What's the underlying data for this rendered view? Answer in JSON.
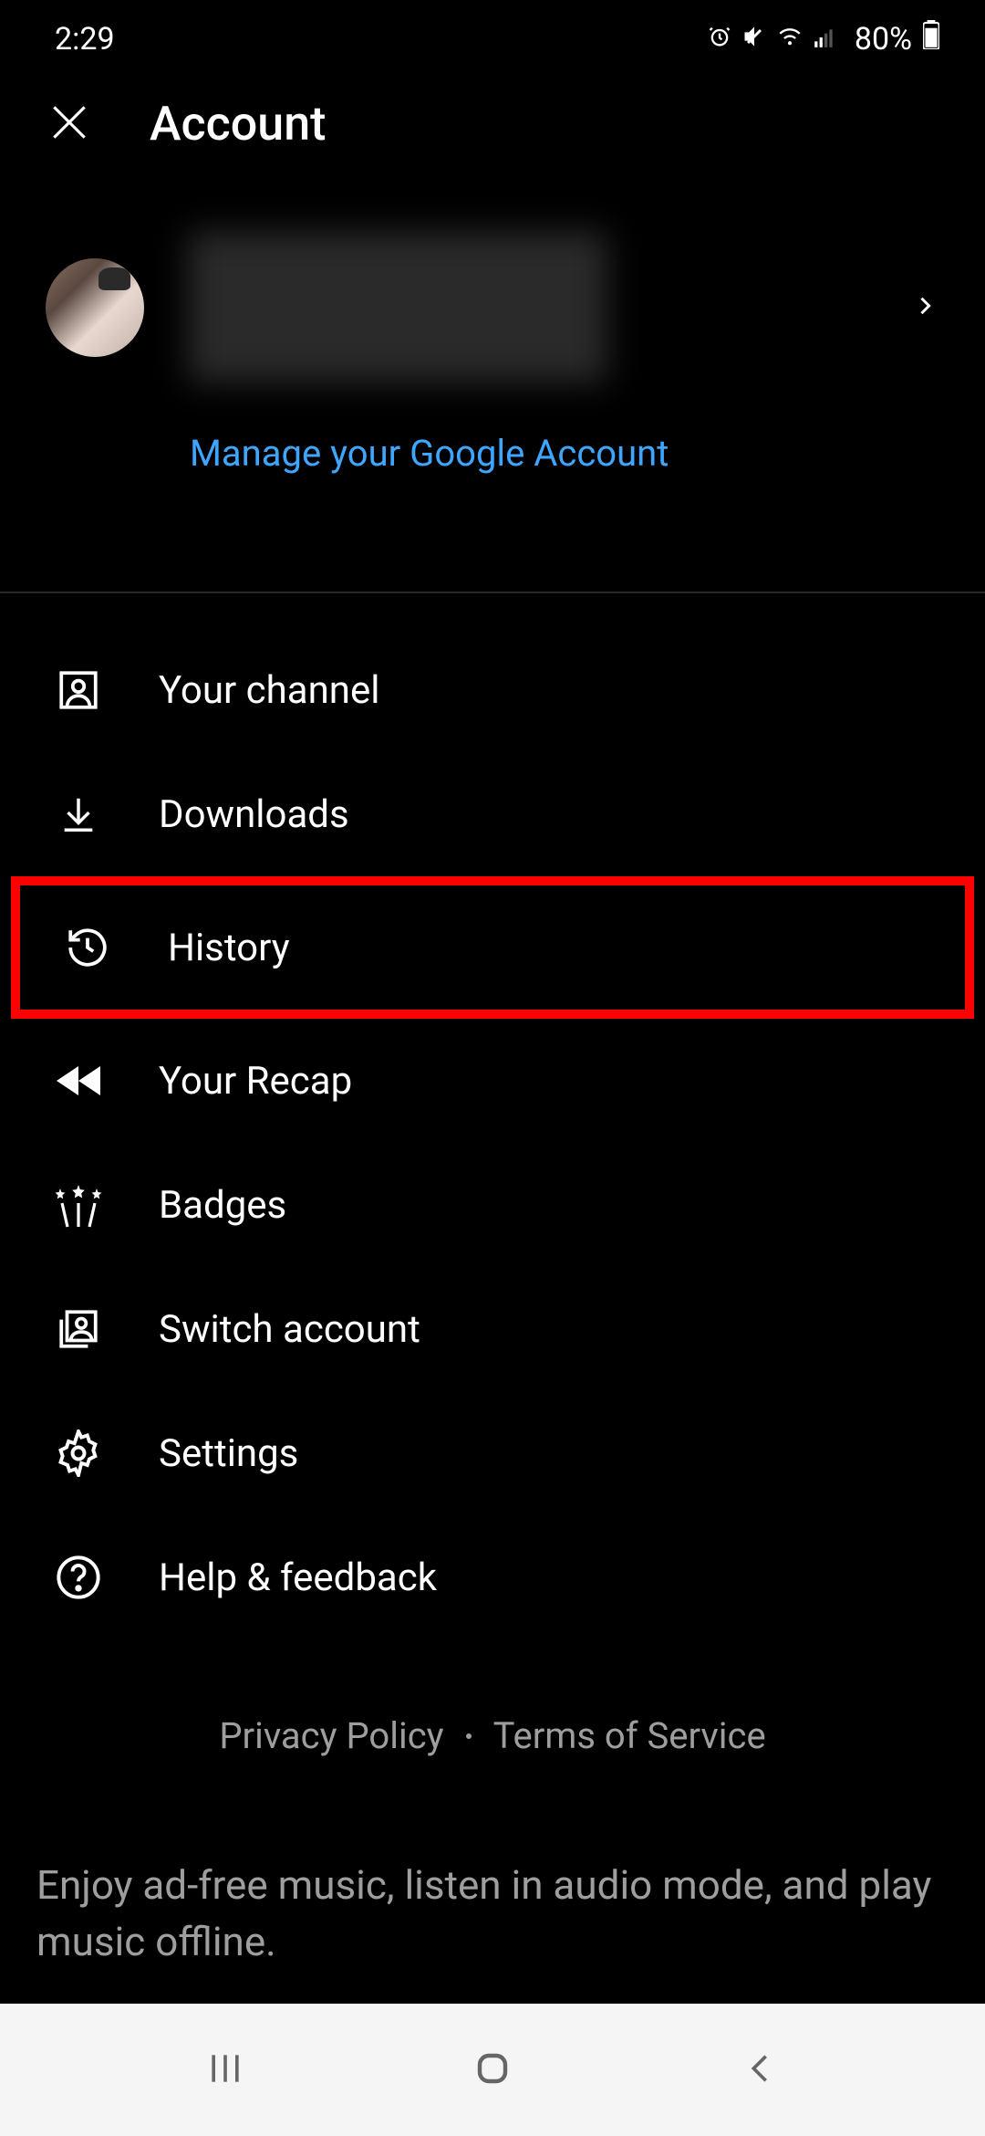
{
  "status": {
    "time": "2:29",
    "battery": "80%"
  },
  "header": {
    "title": "Account"
  },
  "profile": {
    "manage_link": "Manage your Google Account"
  },
  "menu": {
    "items": [
      {
        "icon": "person-box",
        "label": "Your channel"
      },
      {
        "icon": "download",
        "label": "Downloads"
      },
      {
        "icon": "history",
        "label": "History"
      },
      {
        "icon": "rewind",
        "label": "Your Recap"
      },
      {
        "icon": "badges",
        "label": "Badges"
      },
      {
        "icon": "switch-account",
        "label": "Switch account"
      },
      {
        "icon": "settings",
        "label": "Settings"
      },
      {
        "icon": "help",
        "label": "Help & feedback"
      }
    ]
  },
  "footer": {
    "privacy": "Privacy Policy",
    "terms": "Terms of Service",
    "promo": "Enjoy ad-free music, listen in audio mode, and play music offline."
  }
}
